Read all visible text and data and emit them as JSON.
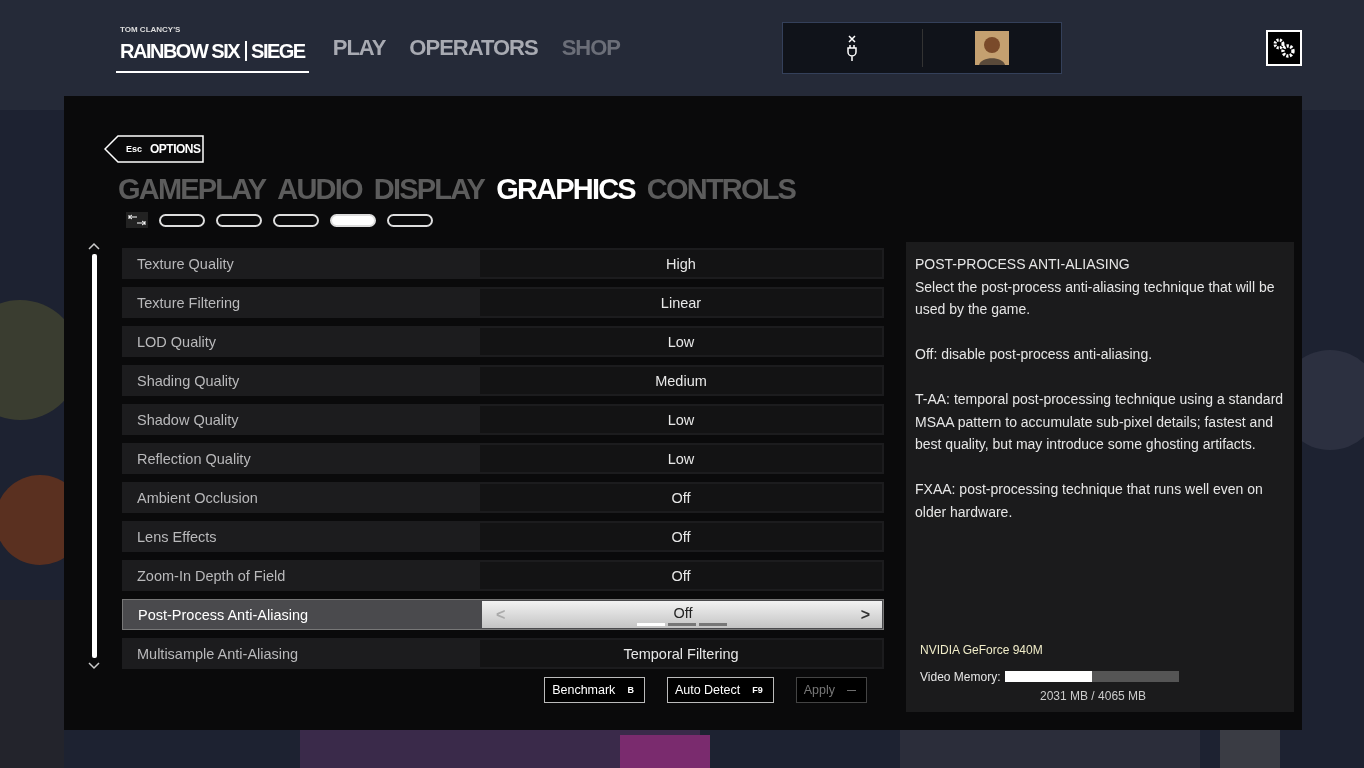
{
  "brand": {
    "publisher": "TOM CLANCY'S",
    "title": "RAINBOW SIX",
    "subtitle": "SIEGE"
  },
  "nav": [
    {
      "label": "PLAY",
      "disabled": false
    },
    {
      "label": "OPERATORS",
      "disabled": false
    },
    {
      "label": "SHOP",
      "disabled": true
    }
  ],
  "back": {
    "key": "Esc",
    "label": "OPTIONS"
  },
  "tabs": [
    {
      "label": "GAMEPLAY",
      "selected": false
    },
    {
      "label": "AUDIO",
      "selected": false
    },
    {
      "label": "DISPLAY",
      "selected": false
    },
    {
      "label": "GRAPHICS",
      "selected": true
    },
    {
      "label": "CONTROLS",
      "selected": false
    }
  ],
  "pages": [
    {
      "selected": false
    },
    {
      "selected": false
    },
    {
      "selected": false
    },
    {
      "selected": true
    },
    {
      "selected": false
    }
  ],
  "settings": [
    {
      "name": "Texture Quality",
      "value": "High",
      "selected": false
    },
    {
      "name": "Texture Filtering",
      "value": "Linear",
      "selected": false
    },
    {
      "name": "LOD Quality",
      "value": "Low",
      "selected": false
    },
    {
      "name": "Shading Quality",
      "value": "Medium",
      "selected": false
    },
    {
      "name": "Shadow Quality",
      "value": "Low",
      "selected": false
    },
    {
      "name": "Reflection Quality",
      "value": "Low",
      "selected": false
    },
    {
      "name": "Ambient Occlusion",
      "value": "Off",
      "selected": false
    },
    {
      "name": "Lens Effects",
      "value": "Off",
      "selected": false
    },
    {
      "name": "Zoom-In Depth of Field",
      "value": "Off",
      "selected": false
    },
    {
      "name": "Post-Process Anti-Aliasing",
      "value": "Off",
      "selected": true,
      "prev": "<",
      "next": ">",
      "options": [
        {
          "selected": true
        },
        {
          "selected": false
        },
        {
          "selected": false
        }
      ]
    },
    {
      "name": "Multisample Anti-Aliasing",
      "value": "Temporal Filtering",
      "selected": false
    }
  ],
  "buttons": [
    {
      "label": "Benchmark",
      "key": "B",
      "disabled": false
    },
    {
      "label": "Auto Detect",
      "key": "F9",
      "disabled": false
    },
    {
      "label": "Apply",
      "key": "—",
      "disabled": true
    }
  ],
  "description": {
    "title": "POST-PROCESS ANTI-ALIASING",
    "paragraphs": [
      "Select the post-process anti-aliasing technique that will be used by the game.",
      "Off: disable post-process anti-aliasing.",
      "T-AA: temporal post-processing technique using a standard MSAA pattern to accumulate sub-pixel details; fastest and best quality, but may introduce some ghosting artifacts.",
      "FXAA: post-processing technique that runs well even on older hardware."
    ]
  },
  "gpu": {
    "name": "NVIDIA GeForce 940M",
    "memory_label": "Video Memory:",
    "level": 0.5,
    "reading": "2031 MB / 4065 MB"
  }
}
